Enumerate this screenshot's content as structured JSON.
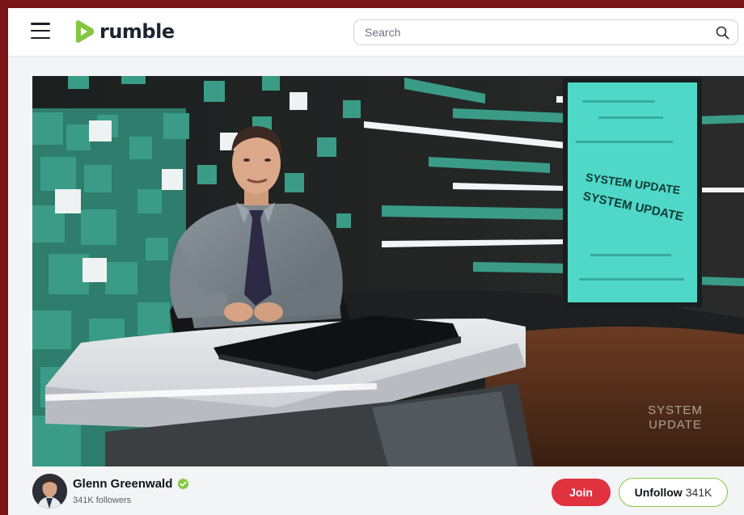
{
  "header": {
    "logo_text": "rumble",
    "search_placeholder": "Search"
  },
  "video": {
    "screen_text": "SYSTEM UPDATE",
    "watermark_line1": "SYSTEM",
    "watermark_line2": "UPDATE"
  },
  "channel": {
    "name": "Glenn Greenwald",
    "followers": "341K followers",
    "join_label": "Join",
    "unfollow_label": "Unfollow",
    "unfollow_count": "341K"
  },
  "colors": {
    "brand_green": "#85c742",
    "join_red": "#e0323f",
    "frame": "#7a1518"
  },
  "icons": [
    "menu-icon",
    "rumble-logo-icon",
    "search-icon",
    "verified-icon"
  ]
}
